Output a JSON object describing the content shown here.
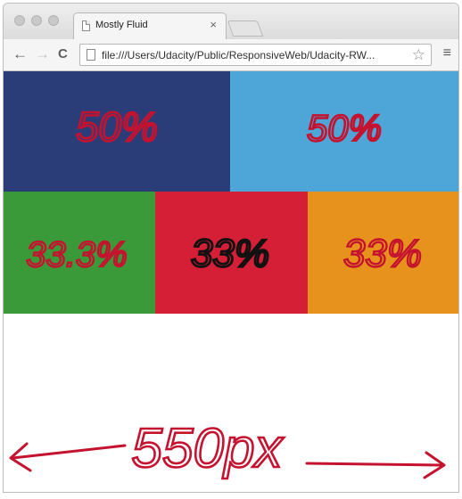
{
  "browser": {
    "tab_title": "Mostly Fluid",
    "tab_close": "×",
    "url": "file:///Users/Udacity/Public/ResponsiveWeb/Udacity-RW...",
    "nav": {
      "back": "←",
      "forward": "→",
      "reload": "C"
    },
    "star": "☆",
    "menu": "≡"
  },
  "boxes": [
    {
      "label": "50%",
      "color": "#2b3d78"
    },
    {
      "label": "50%",
      "color": "#4ea6d8"
    },
    {
      "label": "33.3%",
      "color": "#3a9a3a"
    },
    {
      "label": "33%",
      "color": "#d41f37"
    },
    {
      "label": "33%",
      "color": "#e8921e"
    }
  ],
  "annotation": {
    "text": "550px",
    "ink_color": "#c4122f"
  },
  "colors": {
    "ink": "#c4122f",
    "ink_dark": "#111111"
  }
}
